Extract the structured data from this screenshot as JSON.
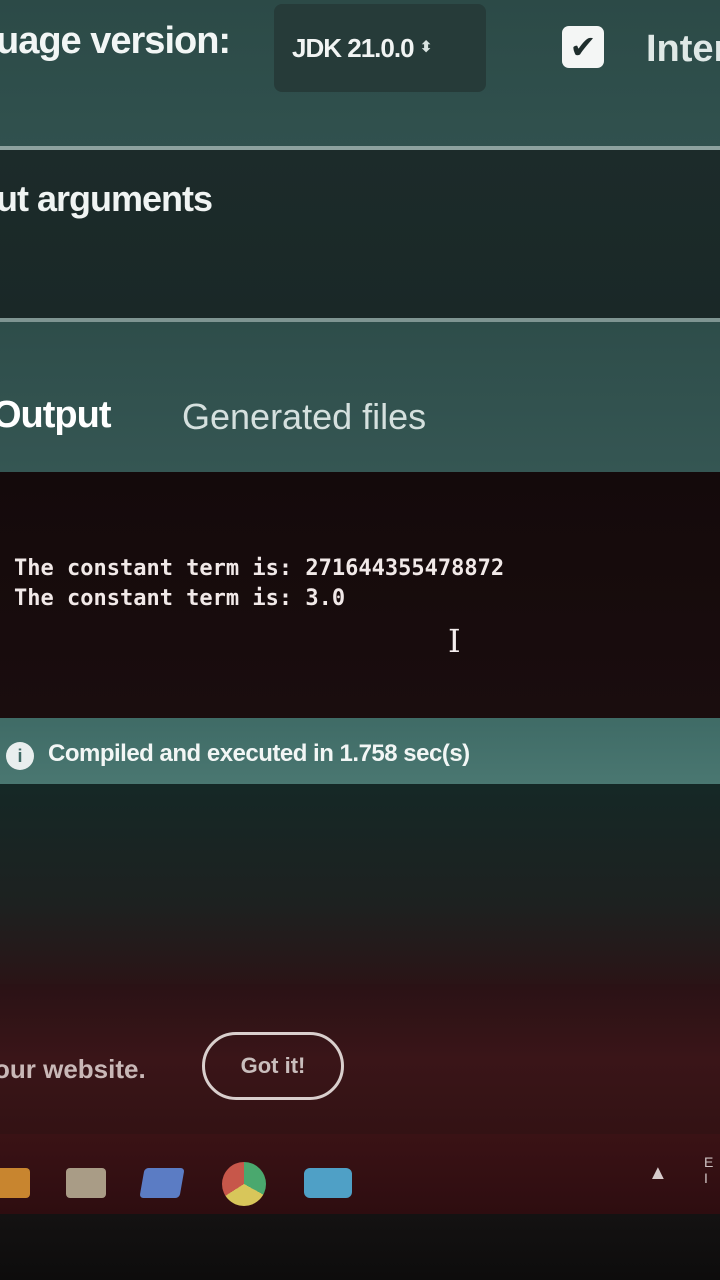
{
  "settings": {
    "language_version_label": "uage version:",
    "jdk_value": "JDK 21.0.0",
    "interactive_checked": true,
    "interactive_label": "Inter"
  },
  "arguments": {
    "label": "ut arguments"
  },
  "tabs": [
    {
      "label": "Output",
      "active": true
    },
    {
      "label": "Generated files",
      "active": false
    }
  ],
  "console": {
    "lines": [
      "The constant term is: 271644355478872",
      "The constant term is: 3.0"
    ]
  },
  "status": {
    "icon": "info-icon",
    "text": "Compiled and executed in 1.758 sec(s)"
  },
  "cookie_banner": {
    "text": "our website.",
    "button_label": "Got it!"
  },
  "taskbar": {
    "icons": [
      "folder-icon",
      "store-icon",
      "photos-icon",
      "chrome-icon",
      "mail-icon"
    ],
    "tray_text": "E\nI"
  },
  "colors": {
    "accent": "#3f6b66",
    "console_bg": "#140a0b"
  }
}
